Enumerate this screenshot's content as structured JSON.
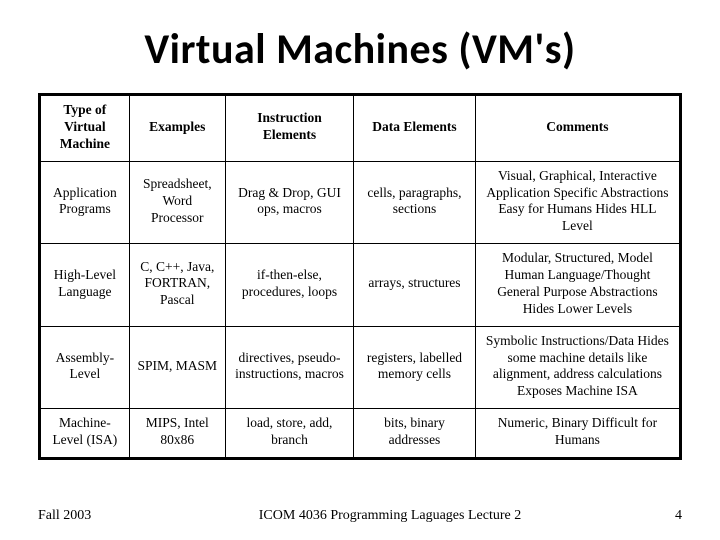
{
  "title": "Virtual Machines (VM's)",
  "table": {
    "headers": [
      "Type of Virtual Machine",
      "Examples",
      "Instruction Elements",
      "Data Elements",
      "Comments"
    ],
    "rows": [
      {
        "type": "Application Programs",
        "examples": "Spreadsheet, Word Processor",
        "instruction": "Drag & Drop, GUI ops, macros",
        "data": "cells, paragraphs, sections",
        "comments": "Visual, Graphical, Interactive Application Specific Abstractions Easy for Humans Hides HLL Level"
      },
      {
        "type": "High-Level Language",
        "examples": "C, C++, Java, FORTRAN, Pascal",
        "instruction": "if-then-else, procedures, loops",
        "data": "arrays, structures",
        "comments": "Modular, Structured, Model Human Language/Thought General Purpose Abstractions Hides Lower Levels"
      },
      {
        "type": "Assembly-Level",
        "examples": "SPIM, MASM",
        "instruction": "directives, pseudo-instructions, macros",
        "data": "registers, labelled memory cells",
        "comments": "Symbolic Instructions/Data Hides some machine details like alignment, address calculations Exposes Machine ISA"
      },
      {
        "type": "Machine-Level (ISA)",
        "examples": "MIPS, Intel 80x86",
        "instruction": "load, store, add, branch",
        "data": "bits, binary addresses",
        "comments": "Numeric, Binary Difficult for Humans"
      }
    ]
  },
  "footer": {
    "left": "Fall 2003",
    "center": "ICOM 4036 Programming Laguages Lecture 2",
    "right": "4"
  }
}
